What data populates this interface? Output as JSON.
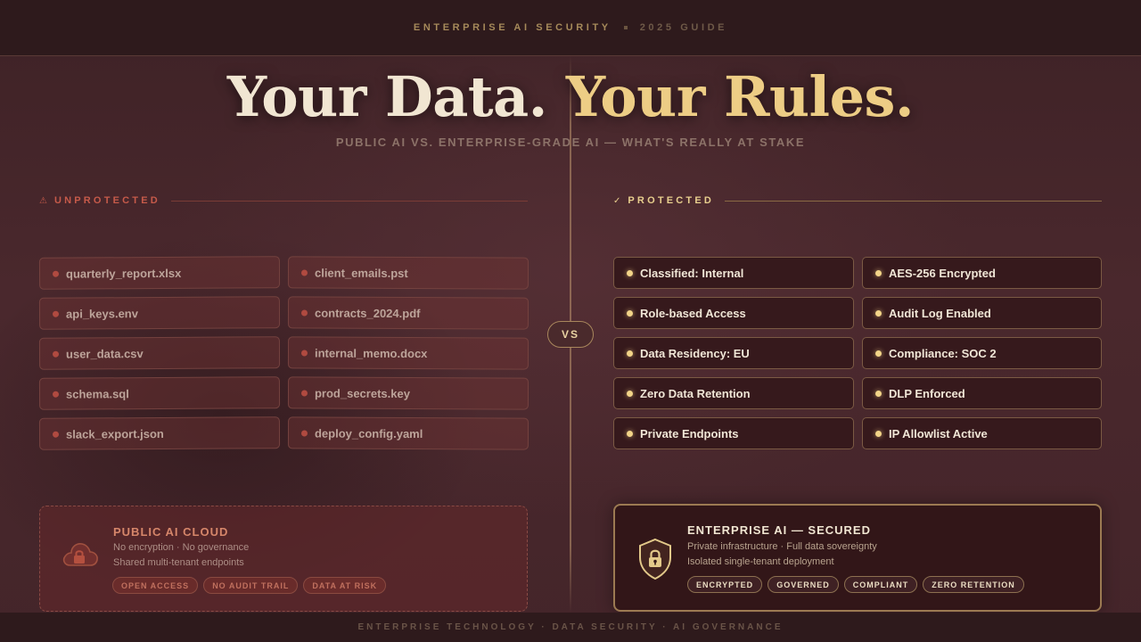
{
  "header": {
    "brand": "ENTERPRISE AI SECURITY",
    "subtitle": "2025 GUIDE"
  },
  "hero": {
    "title_part1": "Your Data.",
    "title_part2": "Your Rules.",
    "subtitle": "PUBLIC AI VS. ENTERPRISE-GRADE AI — WHAT'S REALLY AT STAKE"
  },
  "left": {
    "label_symbol": "⚠",
    "label": "UNPROTECTED",
    "files": [
      "quarterly_report.xlsx",
      "client_emails.pst",
      "api_keys.env",
      "contracts_2024.pdf",
      "user_data.csv",
      "internal_memo.docx",
      "schema.sql",
      "prod_secrets.key",
      "slack_export.json",
      "deploy_config.yaml"
    ],
    "card": {
      "title": "PUBLIC AI CLOUD",
      "line1": "No encryption · No governance",
      "line2": "Shared multi-tenant endpoints",
      "tags": [
        "OPEN ACCESS",
        "NO AUDIT TRAIL",
        "DATA AT RISK"
      ]
    }
  },
  "right": {
    "label_symbol": "✓",
    "label": "PROTECTED",
    "items": [
      "Classified: Internal",
      "AES-256 Encrypted",
      "Role-based Access",
      "Audit Log Enabled",
      "Data Residency: EU",
      "Compliance: SOC 2",
      "Zero Data Retention",
      "DLP Enforced",
      "Private Endpoints",
      "IP Allowlist Active"
    ],
    "card": {
      "title": "ENTERPRISE AI — SECURED",
      "line1": "Private infrastructure · Full data sovereignty",
      "line2": "Isolated single-tenant deployment",
      "tags": [
        "ENCRYPTED",
        "GOVERNED",
        "COMPLIANT",
        "ZERO RETENTION"
      ]
    }
  },
  "vs_label": "VS",
  "footer": "ENTERPRISE TECHNOLOGY · DATA SECURITY · AI GOVERNANCE",
  "icons": {
    "left_card": "cloud-lock-icon",
    "right_card": "shield-lock-icon"
  },
  "colors": {
    "accent_gold": "#edcd85",
    "danger_red": "#c65a4a",
    "background": "#45252a"
  }
}
